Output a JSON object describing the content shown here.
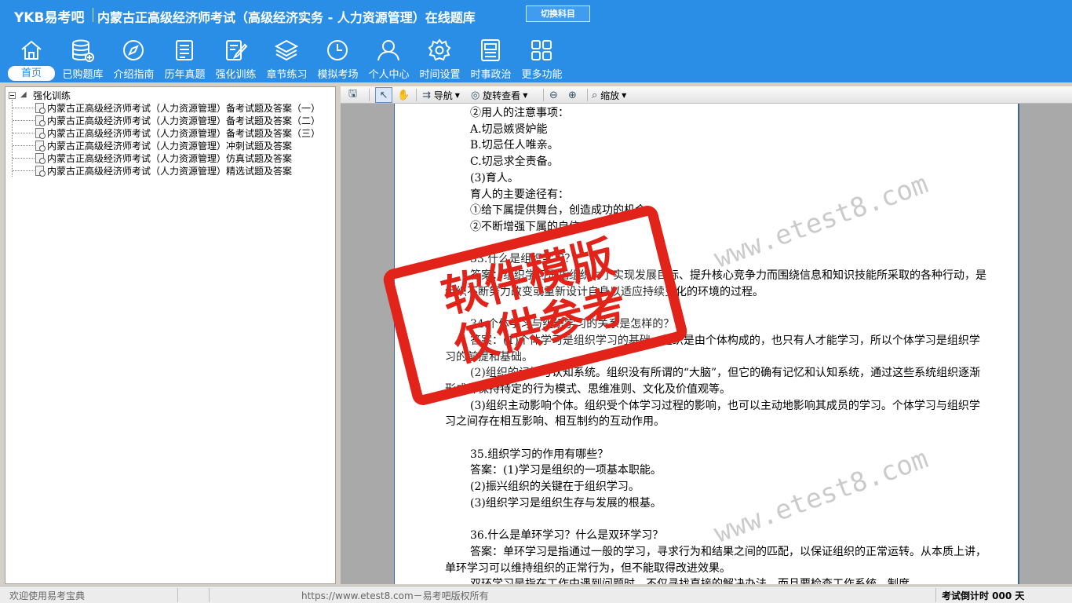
{
  "header": {
    "brand": "YKB易考吧",
    "title": "内蒙古正高级经济师考试（高级经济实务 - 人力资源管理）在线题库",
    "switch_label": "切换科目"
  },
  "nav": [
    {
      "label": "首页",
      "icon": "home-icon"
    },
    {
      "label": "已购题库",
      "icon": "database-icon"
    },
    {
      "label": "介绍指南",
      "icon": "compass-icon"
    },
    {
      "label": "历年真题",
      "icon": "list-icon"
    },
    {
      "label": "强化训练",
      "icon": "edit-icon"
    },
    {
      "label": "章节练习",
      "icon": "layers-icon"
    },
    {
      "label": "模拟考场",
      "icon": "clock-icon"
    },
    {
      "label": "个人中心",
      "icon": "user-icon"
    },
    {
      "label": "时间设置",
      "icon": "gear-icon"
    },
    {
      "label": "时事政治",
      "icon": "news-icon"
    },
    {
      "label": "更多功能",
      "icon": "grid-icon"
    }
  ],
  "tree": {
    "root": "强化训练",
    "items": [
      "内蒙古正高级经济师考试（人力资源管理）备考试题及答案（一）",
      "内蒙古正高级经济师考试（人力资源管理）备考试题及答案（二）",
      "内蒙古正高级经济师考试（人力资源管理）备考试题及答案（三）",
      "内蒙古正高级经济师考试（人力资源管理）冲刺试题及答案",
      "内蒙古正高级经济师考试（人力资源管理）仿真试题及答案",
      "内蒙古正高级经济师考试（人力资源管理）精选试题及答案"
    ]
  },
  "toolbar": {
    "nav_label": "导航",
    "rotate_label": "旋转查看",
    "zoom_label": "缩放"
  },
  "doc": {
    "lines": [
      {
        "t": "②用人的注意事项：",
        "i": true
      },
      {
        "t": "A.切忌嫉贤妒能",
        "i": true
      },
      {
        "t": "B.切忌任人唯亲。",
        "i": true
      },
      {
        "t": "C.切忌求全责备。",
        "i": true
      },
      {
        "t": "(3)育人。",
        "i": true
      },
      {
        "t": "育人的主要途径有：",
        "i": true
      },
      {
        "t": "①给下属提供舞台，创造成功的机会。",
        "i": true
      },
      {
        "t": "②不断增强下属的自信心",
        "i": true
      },
      {
        "t": "",
        "i": false
      },
      {
        "t": "33.什么是组织学习？",
        "i": true
      },
      {
        "t": "答案：组织学习是指组织为了实现发展目标、提升核心竞争力而围绕信息和知识技能所采取的各种行动，是组织不断努力改变或重新设计自身以适应持续变化的环境的过程。",
        "i": true
      },
      {
        "t": "",
        "i": false
      },
      {
        "t": "34.个体学习与组织学习的关系是怎样的？",
        "i": true
      },
      {
        "t": "答案：(1)个体学习是组织学习的基础。组织是由个体构成的，也只有人才能学习，所以个体学习是组织学习的前提和基础。",
        "i": true
      },
      {
        "t": "(2)组织的记忆与认知系统。组织没有所谓的“大脑”，但它的确有记忆和认知系统，通过这些系统组织逐渐形成并保持特定的行为模式、思维准则、文化及价值观等。",
        "i": true
      },
      {
        "t": "(3)组织主动影响个体。组织受个体学习过程的影响，也可以主动地影响其成员的学习。个体学习与组织学习之间存在相互影响、相互制约的互动作用。",
        "i": true
      },
      {
        "t": "",
        "i": false
      },
      {
        "t": "35.组织学习的作用有哪些？",
        "i": true
      },
      {
        "t": "答案：(1)学习是组织的一项基本职能。",
        "i": true
      },
      {
        "t": "(2)振兴组织的关键在于组织学习。",
        "i": true
      },
      {
        "t": "(3)组织学习是组织生存与发展的根基。",
        "i": true
      },
      {
        "t": "",
        "i": false
      },
      {
        "t": "36.什么是单环学习？什么是双环学习？",
        "i": true
      },
      {
        "t": "答案：单环学习是指通过一般的学习，寻求行为和结果之间的匹配，以保证组织的正常运转。从本质上讲，单环学习可以维持组织的正常行为，但不能取得改进效果。",
        "i": true
      },
      {
        "t": "双环学习是指在工作中遇到问题时，不仅寻找直接的解决办法，而且要检查工作系统、制度",
        "i": true
      }
    ],
    "watermark": "www.etest8.com",
    "stamp_line1": "软件模版",
    "stamp_line2": "仅供参考"
  },
  "status": {
    "welcome": "欢迎使用易考宝典",
    "copyright": "https://www.etest8.com－易考吧版权所有",
    "countdown": "考试倒计时 000 天"
  },
  "colors": {
    "header_bg": "#2b8ee6",
    "stamp": "#e2231a"
  }
}
